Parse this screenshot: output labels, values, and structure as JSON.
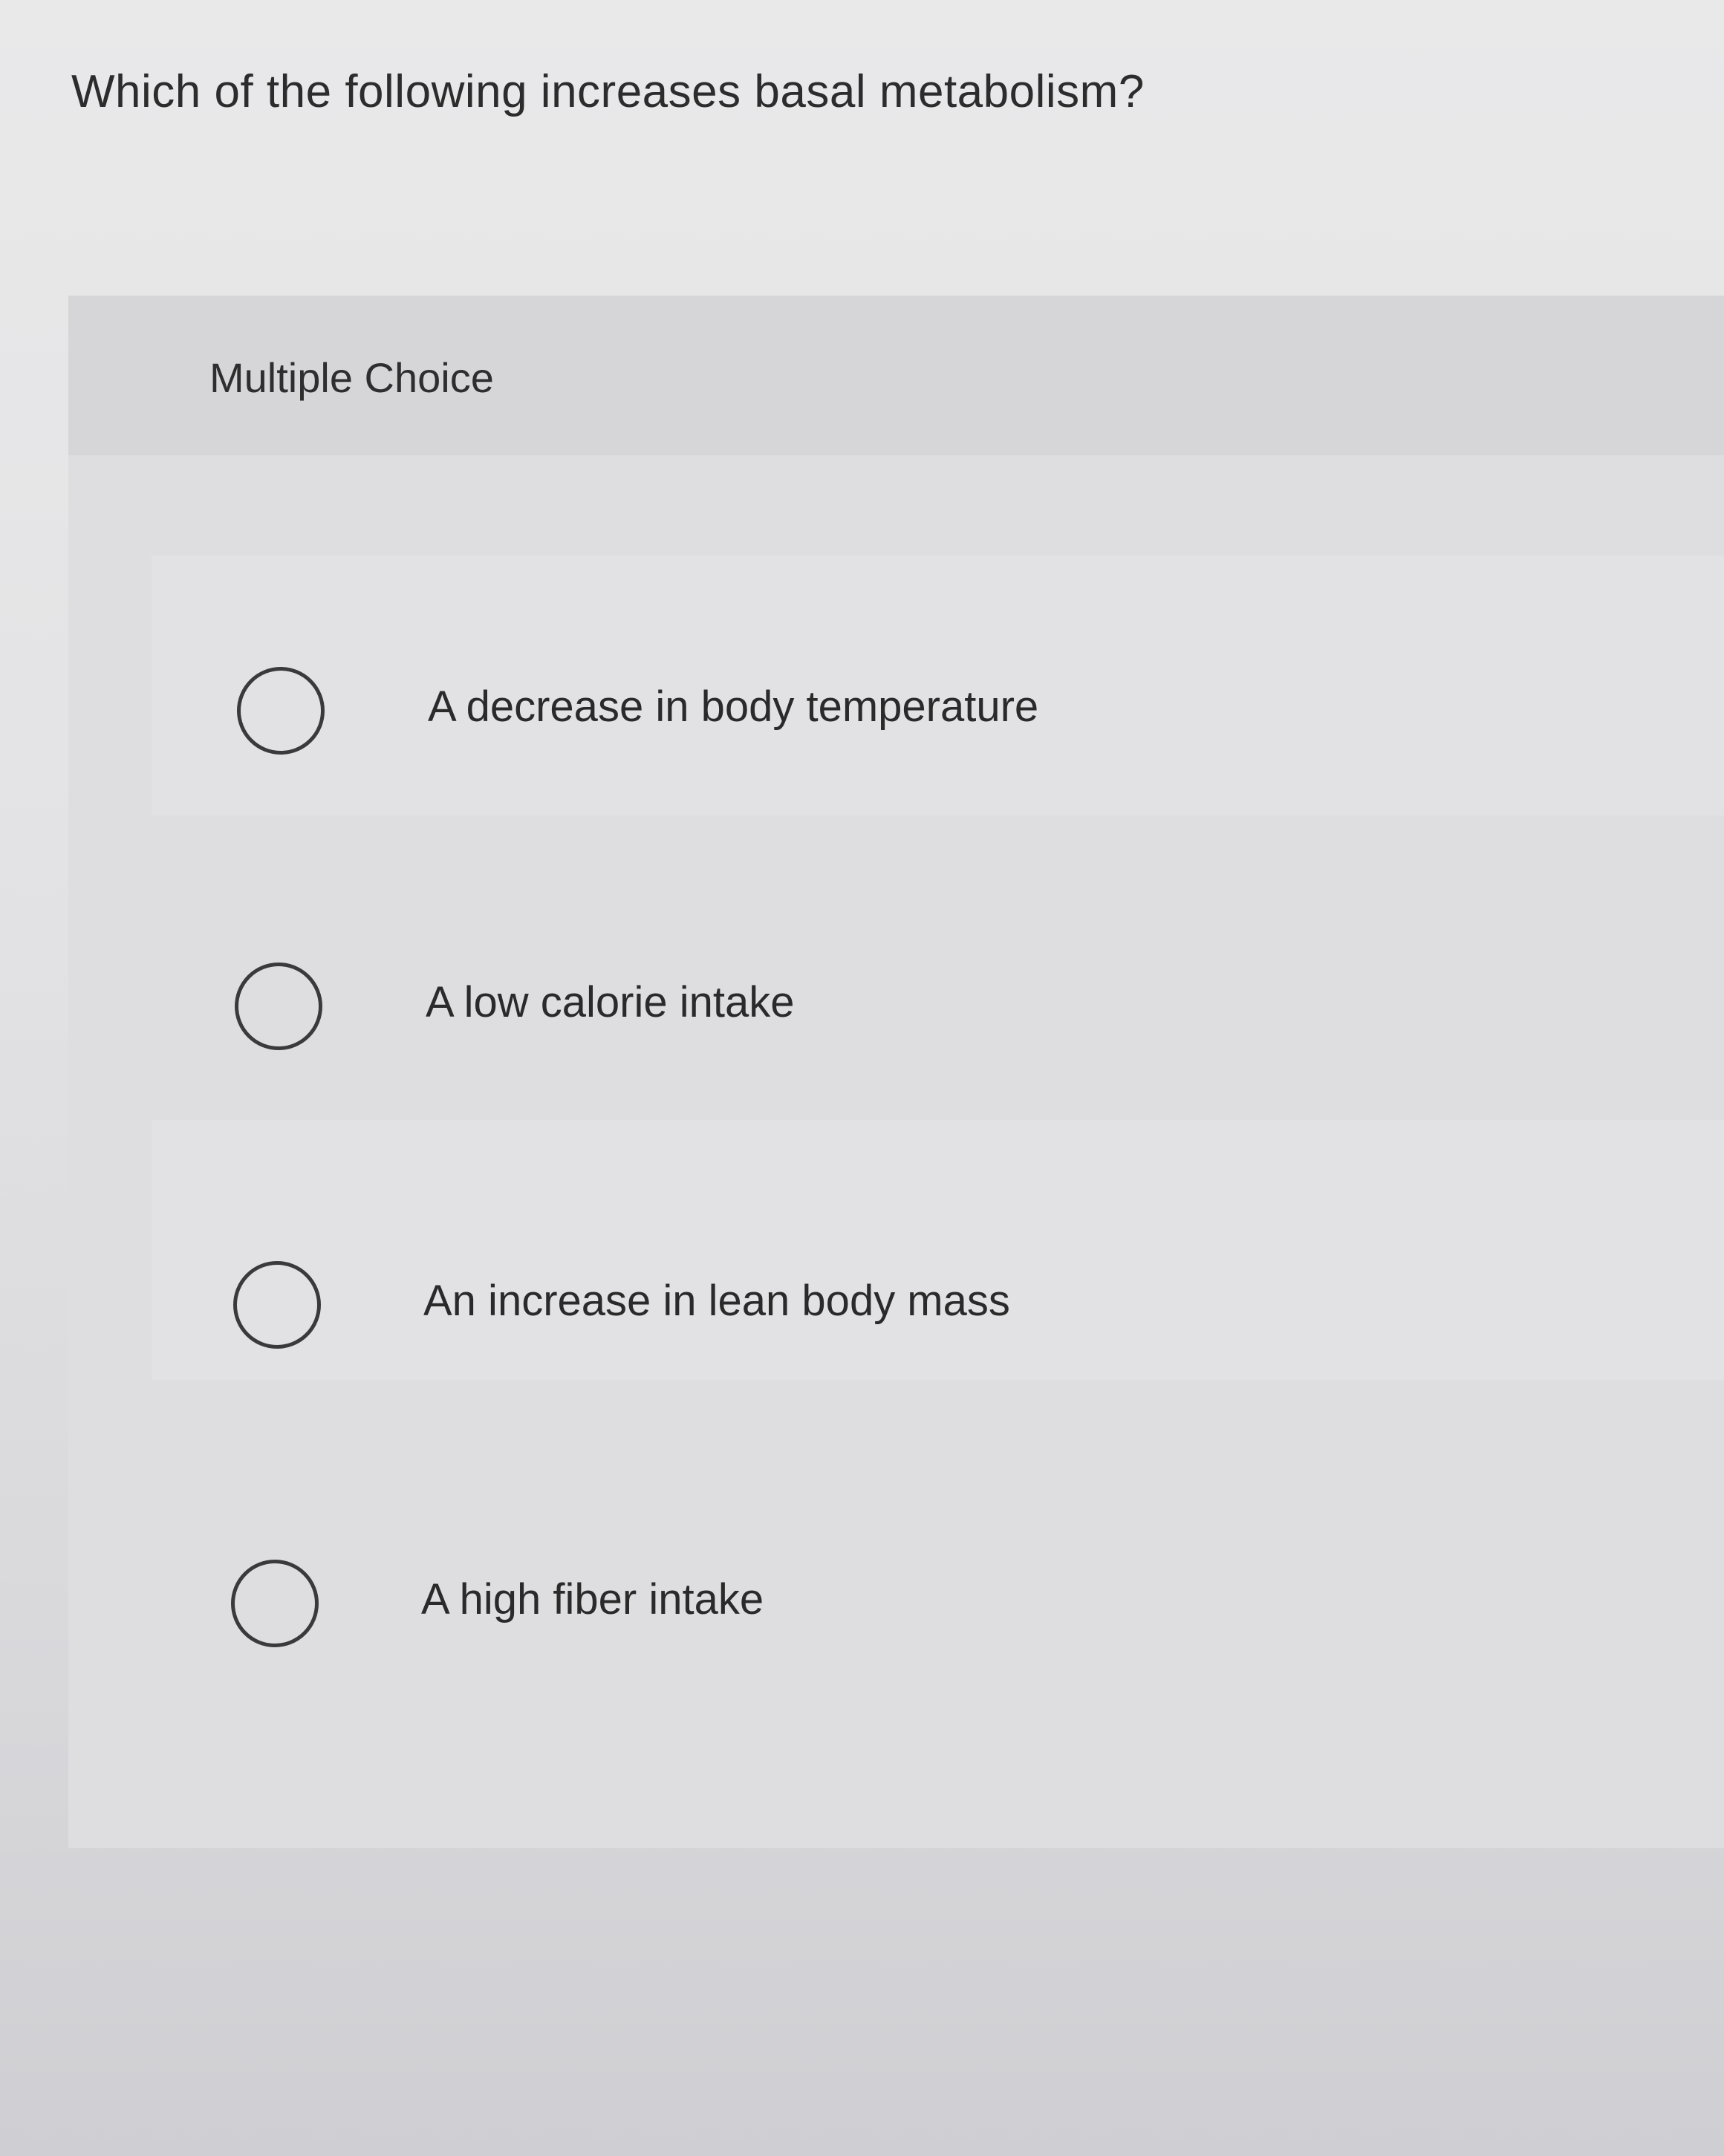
{
  "question": {
    "text": "Which of the following increases basal metabolism?"
  },
  "panel": {
    "label": "Multiple Choice"
  },
  "choices": [
    {
      "label": "A decrease in body temperature",
      "selected": false
    },
    {
      "label": "A low calorie intake",
      "selected": false
    },
    {
      "label": "An increase in lean body mass",
      "selected": false
    },
    {
      "label": "A high fiber intake",
      "selected": false
    }
  ]
}
